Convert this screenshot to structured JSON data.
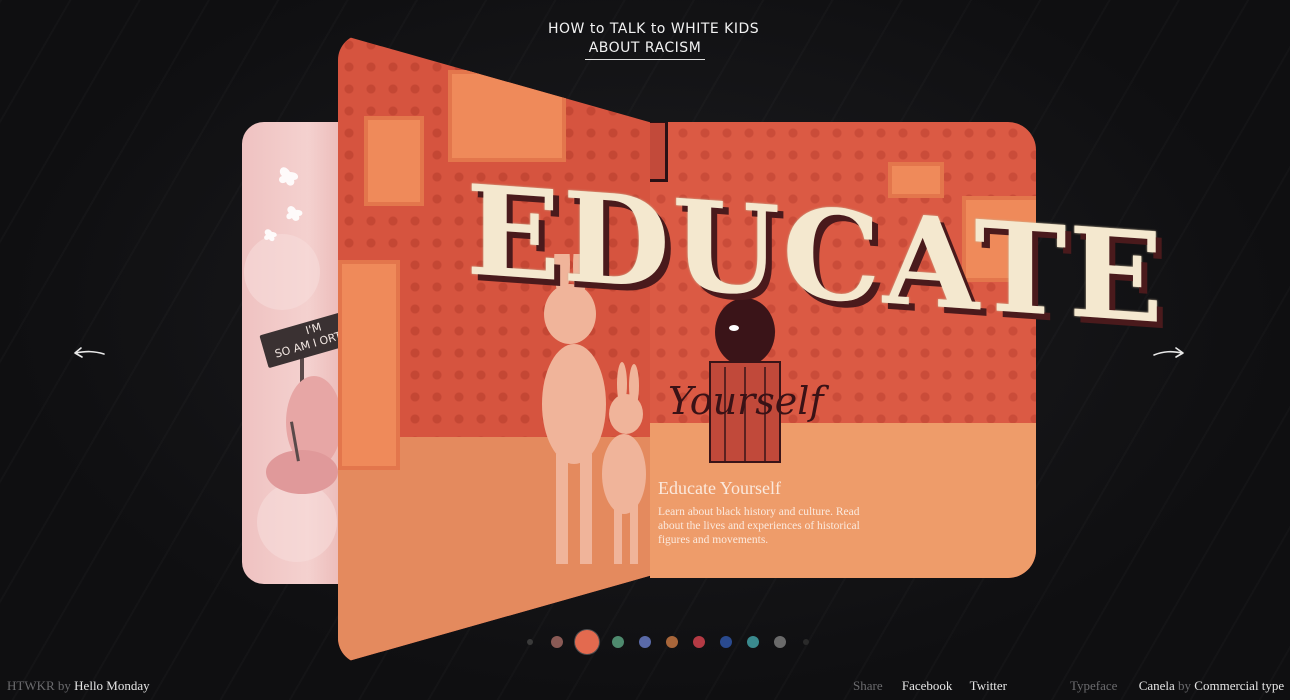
{
  "logo": {
    "line1": "HOW to TALK to WHITE KIDS",
    "line2": "ABOUT RACISM"
  },
  "navigation": {
    "prev_icon": "arrow-left-icon",
    "next_icon": "arrow-right-icon"
  },
  "back_page": {
    "sign_line1": "I'M",
    "sign_line2": "SO AM I",
    "sign_line3": "ORTA"
  },
  "spread": {
    "title_art": "EDUCATE",
    "subtitle_art": "Yourself",
    "info_title": "Educate Yourself",
    "info_body": "Learn about black history and culture. Read about the lives and experiences of historical figures and movements."
  },
  "page_dots": {
    "count": 11,
    "active_index": 2,
    "colors": [
      "#3a3a3a",
      "#8a5a55",
      "#e36a4f",
      "#4e8a6e",
      "#5a6aa8",
      "#a8663a",
      "#b43a44",
      "#2a4a8e",
      "#3a8a8e",
      "#6a6a6a",
      "#2a2a2a"
    ]
  },
  "footer": {
    "left": {
      "abbr": "HTWKR",
      "by": "by",
      "studio": "Hello Monday"
    },
    "share": {
      "label": "Share",
      "facebook": "Facebook",
      "twitter": "Twitter"
    },
    "typeface": {
      "label": "Typeface",
      "font": "Canela",
      "by": "by",
      "foundry": "Commercial type"
    }
  },
  "colors": {
    "background": "#111113",
    "page_red": "#d6543f",
    "lettering": "#f4e8cf",
    "back_page_pink": "#f4d1cf"
  }
}
